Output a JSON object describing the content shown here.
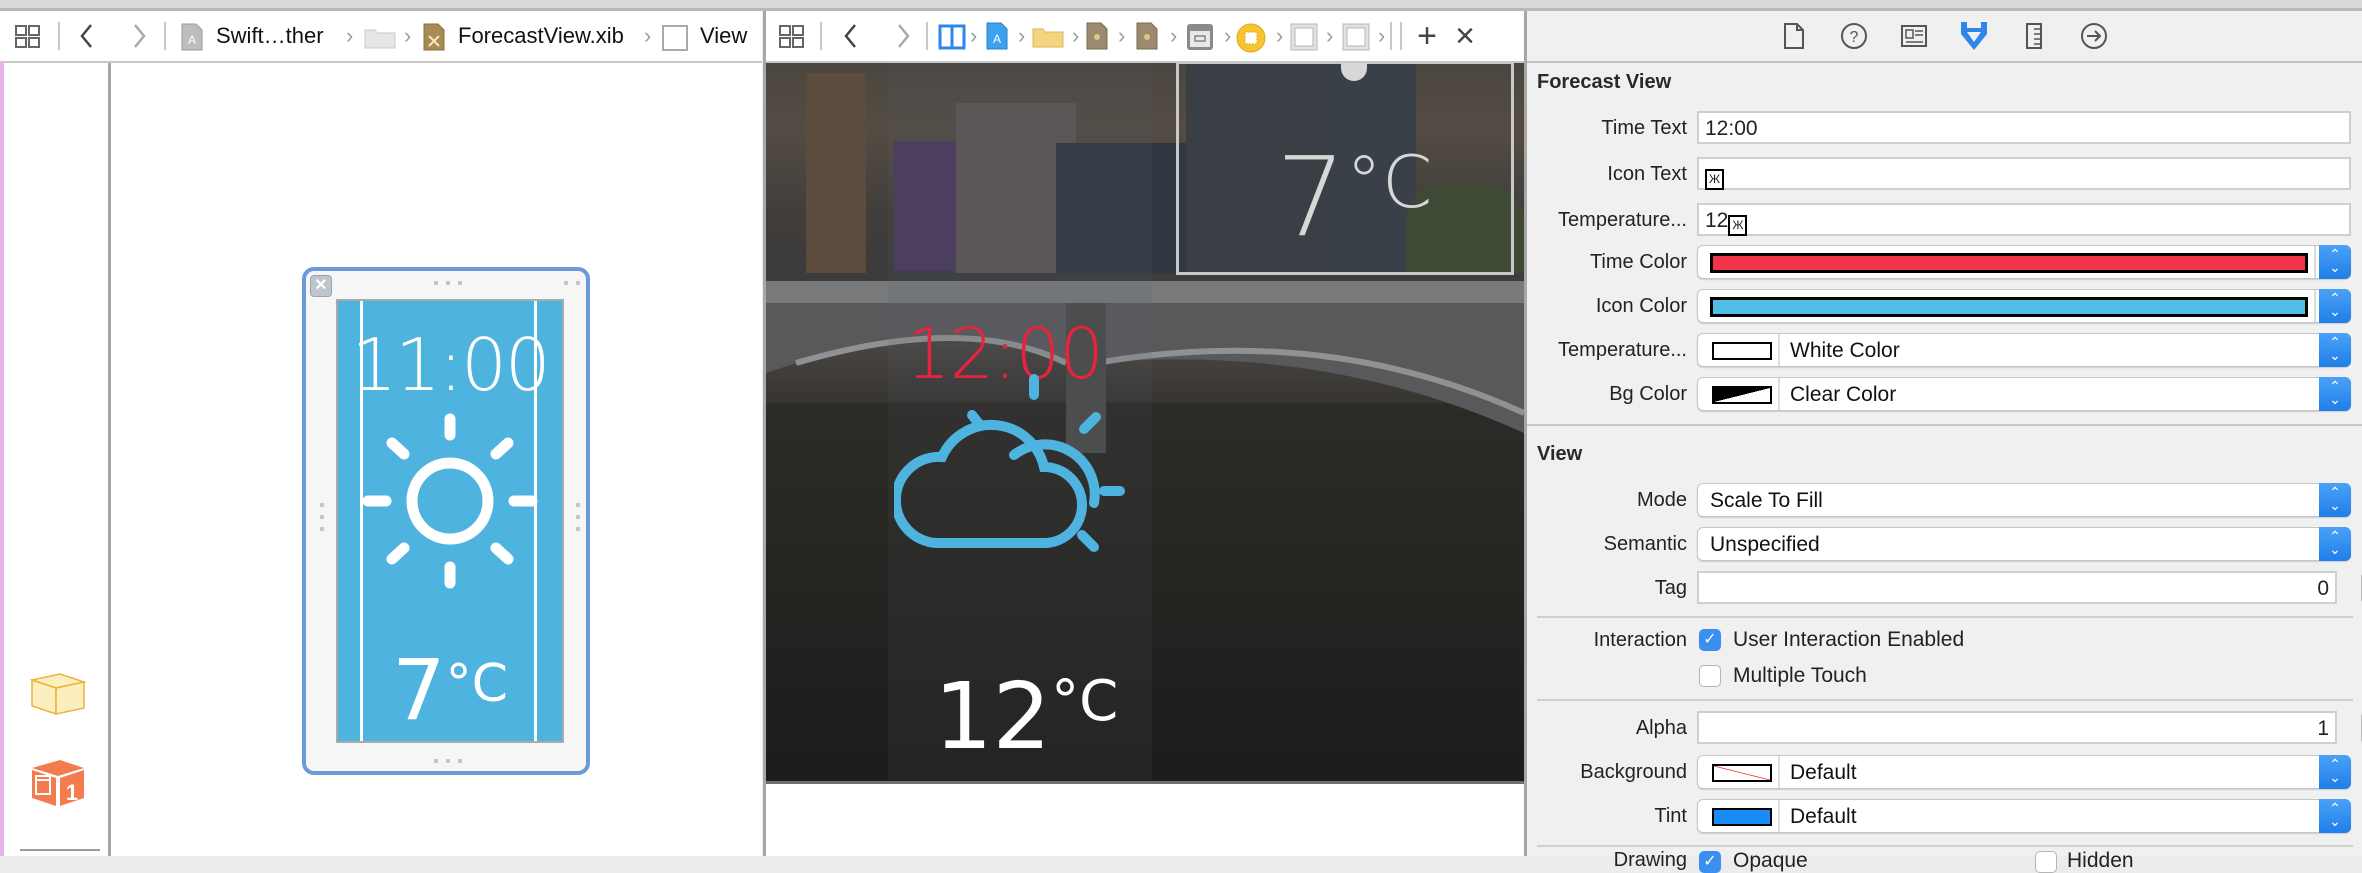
{
  "left_editor": {
    "breadcrumb": [
      {
        "icon": "xcode-project-icon",
        "label": "Swift…ther"
      },
      {
        "icon": "folder-icon",
        "label": ""
      },
      {
        "icon": "xib-file-icon",
        "label": "ForecastView.xib"
      },
      {
        "icon": "view-icon",
        "label": "View"
      }
    ],
    "xib_preview": {
      "time": "11:00",
      "icon": "sun-icon",
      "temperature": "7",
      "unit": "°C",
      "background_color": "#4fb3e0"
    },
    "sidebar_objects": [
      {
        "icon": "placeholder-cube-icon"
      },
      {
        "icon": "first-responder-cube-icon",
        "badge": "1"
      }
    ]
  },
  "center_editor": {
    "breadcrumb_icons": [
      "split-editor-icon",
      "xcode-project-icon",
      "folder-icon",
      "storyboard-file-icon",
      "storyboard-file-icon",
      "view-controller-scene-icon",
      "view-controller-icon",
      "view-icon",
      "view-icon"
    ],
    "add_label": "+",
    "close_label": "×",
    "preview": {
      "small_temperature": "7",
      "small_unit": "°C",
      "time": "12:00",
      "icon": "partly-cloudy-icon",
      "temperature": "12",
      "unit": "°C",
      "time_color": "#e8233d",
      "icon_color": "#4fb3e0"
    }
  },
  "inspector": {
    "tabs": [
      {
        "icon": "file-inspector-icon",
        "active": false
      },
      {
        "icon": "quick-help-icon",
        "active": false
      },
      {
        "icon": "identity-inspector-icon",
        "active": false
      },
      {
        "icon": "attributes-inspector-icon",
        "active": true
      },
      {
        "icon": "size-inspector-icon",
        "active": false
      },
      {
        "icon": "connections-inspector-icon",
        "active": false
      }
    ],
    "forecast_view": {
      "title": "Forecast View",
      "time_text": {
        "label": "Time Text",
        "value": "12:00"
      },
      "icon_text": {
        "label": "Icon Text",
        "value": ""
      },
      "temperature_text": {
        "label": "Temperature...",
        "value": "12",
        "glyph": ""
      },
      "time_color": {
        "label": "Time Color",
        "color": "#f0344a"
      },
      "icon_color": {
        "label": "Icon Color",
        "color": "#4fbfe6"
      },
      "temperature_color": {
        "label": "Temperature...",
        "value": "White Color",
        "color": "#ffffff"
      },
      "bg_color": {
        "label": "Bg Color",
        "value": "Clear Color"
      }
    },
    "view": {
      "title": "View",
      "mode": {
        "label": "Mode",
        "value": "Scale To Fill"
      },
      "semantic": {
        "label": "Semantic",
        "value": "Unspecified"
      },
      "tag": {
        "label": "Tag",
        "value": "0"
      },
      "interaction": {
        "label": "Interaction",
        "user_interaction_enabled": {
          "label": "User Interaction Enabled",
          "checked": true
        },
        "multiple_touch": {
          "label": "Multiple Touch",
          "checked": false
        }
      },
      "alpha": {
        "label": "Alpha",
        "value": "1"
      },
      "background": {
        "label": "Background",
        "value": "Default"
      },
      "tint": {
        "label": "Tint",
        "value": "Default",
        "color": "#1a8cf5"
      },
      "drawing": {
        "label": "Drawing",
        "opaque": {
          "label": "Opaque",
          "checked": true
        },
        "hidden": {
          "label": "Hidden",
          "checked": false
        }
      }
    }
  }
}
